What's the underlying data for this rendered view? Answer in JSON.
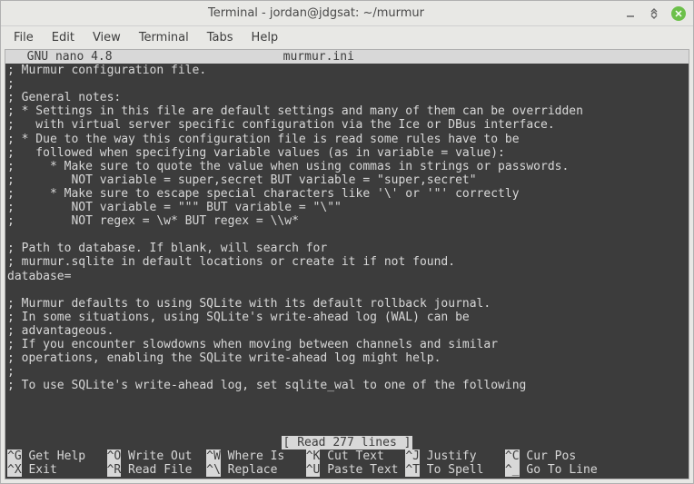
{
  "window": {
    "title": "Terminal - jordan@jdgsat: ~/murmur"
  },
  "menubar": {
    "items": [
      "File",
      "Edit",
      "View",
      "Terminal",
      "Tabs",
      "Help"
    ]
  },
  "nano": {
    "version": "  GNU nano 4.8",
    "filename": "murmur.ini",
    "status": "[ Read 277 lines ]",
    "lines": [
      "; Murmur configuration file.",
      ";",
      "; General notes:",
      "; * Settings in this file are default settings and many of them can be overridden",
      ";   with virtual server specific configuration via the Ice or DBus interface.",
      "; * Due to the way this configuration file is read some rules have to be",
      ";   followed when specifying variable values (as in variable = value):",
      ";     * Make sure to quote the value when using commas in strings or passwords.",
      ";        NOT variable = super,secret BUT variable = \"super,secret\"",
      ";     * Make sure to escape special characters like '\\' or '\"' correctly",
      ";        NOT variable = \"\"\" BUT variable = \"\\\"\"",
      ";        NOT regex = \\w* BUT regex = \\\\w*",
      "",
      "; Path to database. If blank, will search for",
      "; murmur.sqlite in default locations or create it if not found.",
      "database=",
      "",
      "; Murmur defaults to using SQLite with its default rollback journal.",
      "; In some situations, using SQLite's write-ahead log (WAL) can be",
      "; advantageous.",
      "; If you encounter slowdowns when moving between channels and similar",
      "; operations, enabling the SQLite write-ahead log might help.",
      ";",
      "; To use SQLite's write-ahead log, set sqlite_wal to one of the following"
    ],
    "shortcuts": [
      {
        "k": "^G",
        "l": "Get Help"
      },
      {
        "k": "^O",
        "l": "Write Out"
      },
      {
        "k": "^W",
        "l": "Where Is"
      },
      {
        "k": "^K",
        "l": "Cut Text"
      },
      {
        "k": "^J",
        "l": "Justify"
      },
      {
        "k": "^C",
        "l": "Cur Pos"
      },
      {
        "k": "^X",
        "l": "Exit"
      },
      {
        "k": "^R",
        "l": "Read File"
      },
      {
        "k": "^\\",
        "l": "Replace"
      },
      {
        "k": "^U",
        "l": "Paste Text"
      },
      {
        "k": "^T",
        "l": "To Spell"
      },
      {
        "k": "^_",
        "l": "Go To Line"
      }
    ]
  }
}
